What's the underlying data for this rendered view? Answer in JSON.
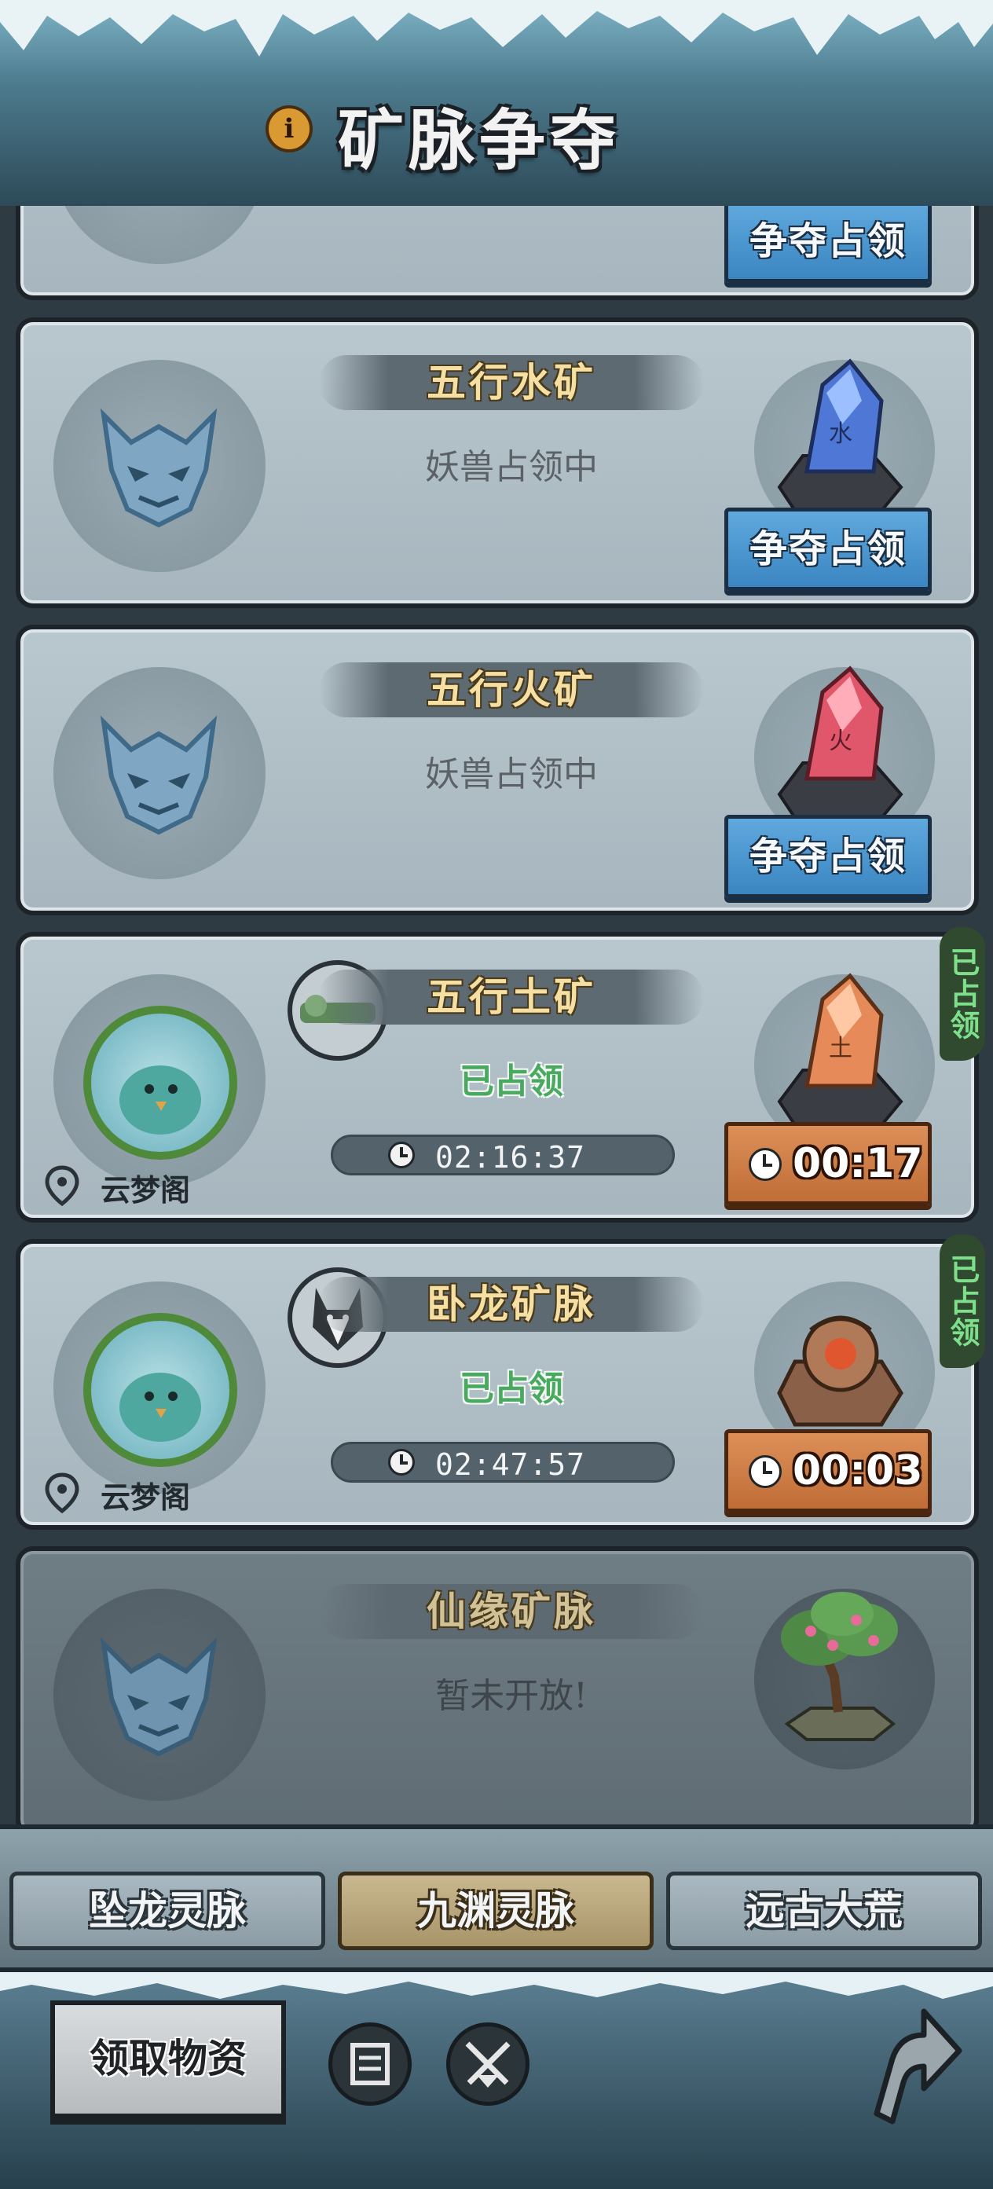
{
  "header": {
    "title": "矿脉争夺",
    "info_icon": "info-icon",
    "accent_color": "#d99a33"
  },
  "mines": [
    {
      "name": "",
      "status": "",
      "action_label": "争夺占领",
      "partial": true
    },
    {
      "name": "五行水矿",
      "status": "妖兽占领中",
      "action_label": "争夺占领",
      "mineral_icon": "water-crystal-icon",
      "mineral_glyph": "水",
      "mineral_color": "#4f78d6"
    },
    {
      "name": "五行火矿",
      "status": "妖兽占领中",
      "action_label": "争夺占领",
      "mineral_icon": "fire-crystal-icon",
      "mineral_glyph": "火",
      "mineral_color": "#e0566a"
    },
    {
      "name": "五行土矿",
      "status": "已占领",
      "timer": "02:16:37",
      "cooldown": "00:17",
      "guild": "云梦阁",
      "occupied_tag": "已占领",
      "mineral_icon": "earth-crystal-icon",
      "mineral_glyph": "土",
      "mineral_color": "#e68a5a"
    },
    {
      "name": "卧龙矿脉",
      "status": "已占领",
      "timer": "02:47:57",
      "cooldown": "00:03",
      "guild": "云梦阁",
      "occupied_tag": "已占领",
      "mineral_icon": "dragon-ore-icon"
    },
    {
      "name": "仙缘矿脉",
      "status": "暂未开放!",
      "mineral_icon": "bonsai-tree-icon"
    }
  ],
  "tabs": [
    {
      "label": "坠龙灵脉",
      "active": false
    },
    {
      "label": "九渊灵脉",
      "active": true
    },
    {
      "label": "远古大荒",
      "active": false
    }
  ],
  "bottom": {
    "claim_label": "领取物资",
    "scroll_icon": "scroll-icon",
    "battle_icon": "crossed-swords-icon",
    "back_icon": "back-arrow-icon"
  }
}
